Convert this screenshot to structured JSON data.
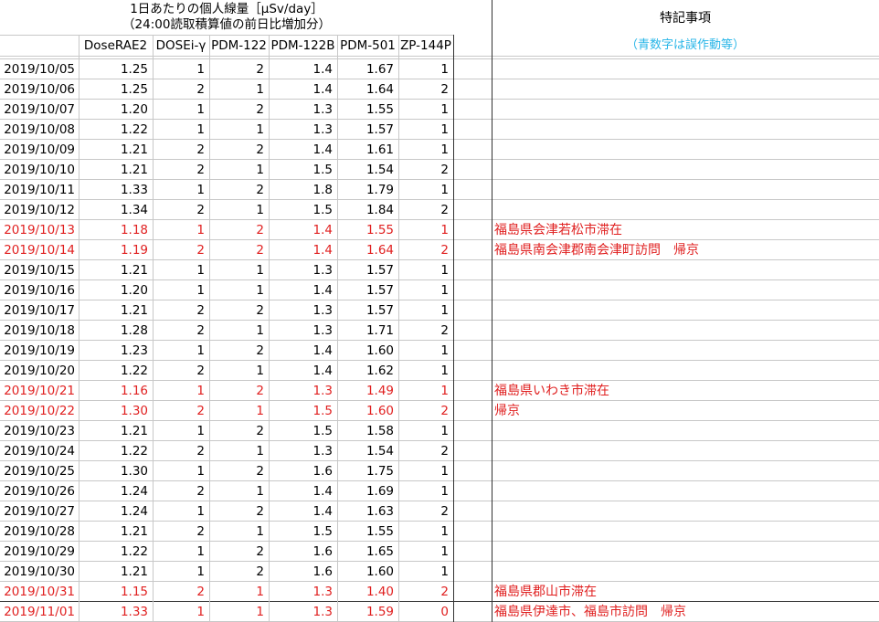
{
  "header": {
    "title_line1": "1日あたりの個人線量［μSv/day］",
    "title_line2": "（24:00読取積算値の前日比増加分）",
    "notes_title": "特記事項",
    "notes_legend": "（青数字は誤作動等）"
  },
  "columns": [
    "DoseRAE2",
    "DOSEi-γ",
    "PDM-122",
    "PDM-122B",
    "PDM-501",
    "ZP-144P"
  ],
  "colors": {
    "highlight": "#e02020",
    "legend": "#29b6e8",
    "grid": "#c8c8c8"
  },
  "rows": [
    {
      "date": "2019/10/05",
      "values": [
        "1.25",
        "1",
        "2",
        "1.4",
        "1.67",
        "1"
      ],
      "note": "",
      "highlight": false
    },
    {
      "date": "2019/10/06",
      "values": [
        "1.25",
        "2",
        "1",
        "1.4",
        "1.64",
        "2"
      ],
      "note": "",
      "highlight": false
    },
    {
      "date": "2019/10/07",
      "values": [
        "1.20",
        "1",
        "2",
        "1.3",
        "1.55",
        "1"
      ],
      "note": "",
      "highlight": false
    },
    {
      "date": "2019/10/08",
      "values": [
        "1.22",
        "1",
        "1",
        "1.3",
        "1.57",
        "1"
      ],
      "note": "",
      "highlight": false
    },
    {
      "date": "2019/10/09",
      "values": [
        "1.21",
        "2",
        "2",
        "1.4",
        "1.61",
        "1"
      ],
      "note": "",
      "highlight": false
    },
    {
      "date": "2019/10/10",
      "values": [
        "1.21",
        "2",
        "1",
        "1.5",
        "1.54",
        "2"
      ],
      "note": "",
      "highlight": false
    },
    {
      "date": "2019/10/11",
      "values": [
        "1.33",
        "1",
        "2",
        "1.8",
        "1.79",
        "1"
      ],
      "note": "",
      "highlight": false
    },
    {
      "date": "2019/10/12",
      "values": [
        "1.34",
        "2",
        "1",
        "1.5",
        "1.84",
        "2"
      ],
      "note": "",
      "highlight": false
    },
    {
      "date": "2019/10/13",
      "values": [
        "1.18",
        "1",
        "2",
        "1.4",
        "1.55",
        "1"
      ],
      "note": "福島県会津若松市滞在",
      "highlight": true
    },
    {
      "date": "2019/10/14",
      "values": [
        "1.19",
        "2",
        "2",
        "1.4",
        "1.64",
        "2"
      ],
      "note": "福島県南会津郡南会津町訪問　帰京",
      "highlight": true
    },
    {
      "date": "2019/10/15",
      "values": [
        "1.21",
        "1",
        "1",
        "1.3",
        "1.57",
        "1"
      ],
      "note": "",
      "highlight": false
    },
    {
      "date": "2019/10/16",
      "values": [
        "1.20",
        "1",
        "1",
        "1.4",
        "1.57",
        "1"
      ],
      "note": "",
      "highlight": false
    },
    {
      "date": "2019/10/17",
      "values": [
        "1.21",
        "2",
        "2",
        "1.3",
        "1.57",
        "1"
      ],
      "note": "",
      "highlight": false
    },
    {
      "date": "2019/10/18",
      "values": [
        "1.28",
        "2",
        "1",
        "1.3",
        "1.71",
        "2"
      ],
      "note": "",
      "highlight": false
    },
    {
      "date": "2019/10/19",
      "values": [
        "1.23",
        "1",
        "2",
        "1.4",
        "1.60",
        "1"
      ],
      "note": "",
      "highlight": false
    },
    {
      "date": "2019/10/20",
      "values": [
        "1.22",
        "2",
        "1",
        "1.4",
        "1.62",
        "1"
      ],
      "note": "",
      "highlight": false
    },
    {
      "date": "2019/10/21",
      "values": [
        "1.16",
        "1",
        "2",
        "1.3",
        "1.49",
        "1"
      ],
      "note": "福島県いわき市滞在",
      "highlight": true
    },
    {
      "date": "2019/10/22",
      "values": [
        "1.30",
        "2",
        "1",
        "1.5",
        "1.60",
        "2"
      ],
      "note": "帰京",
      "highlight": true
    },
    {
      "date": "2019/10/23",
      "values": [
        "1.21",
        "1",
        "2",
        "1.5",
        "1.58",
        "1"
      ],
      "note": "",
      "highlight": false
    },
    {
      "date": "2019/10/24",
      "values": [
        "1.22",
        "2",
        "1",
        "1.3",
        "1.54",
        "2"
      ],
      "note": "",
      "highlight": false
    },
    {
      "date": "2019/10/25",
      "values": [
        "1.30",
        "1",
        "2",
        "1.6",
        "1.75",
        "1"
      ],
      "note": "",
      "highlight": false
    },
    {
      "date": "2019/10/26",
      "values": [
        "1.24",
        "2",
        "1",
        "1.4",
        "1.69",
        "1"
      ],
      "note": "",
      "highlight": false
    },
    {
      "date": "2019/10/27",
      "values": [
        "1.24",
        "1",
        "2",
        "1.4",
        "1.63",
        "2"
      ],
      "note": "",
      "highlight": false
    },
    {
      "date": "2019/10/28",
      "values": [
        "1.21",
        "2",
        "1",
        "1.5",
        "1.55",
        "1"
      ],
      "note": "",
      "highlight": false
    },
    {
      "date": "2019/10/29",
      "values": [
        "1.22",
        "1",
        "2",
        "1.6",
        "1.65",
        "1"
      ],
      "note": "",
      "highlight": false
    },
    {
      "date": "2019/10/30",
      "values": [
        "1.21",
        "1",
        "2",
        "1.6",
        "1.60",
        "1"
      ],
      "note": "",
      "highlight": false
    },
    {
      "date": "2019/10/31",
      "values": [
        "1.15",
        "2",
        "1",
        "1.3",
        "1.40",
        "2"
      ],
      "note": "福島県郡山市滞在",
      "highlight": true
    },
    {
      "date": "2019/11/01",
      "values": [
        "1.33",
        "1",
        "1",
        "1.3",
        "1.59",
        "0"
      ],
      "note": "福島県伊達市、福島市訪問　帰京",
      "highlight": true
    }
  ]
}
